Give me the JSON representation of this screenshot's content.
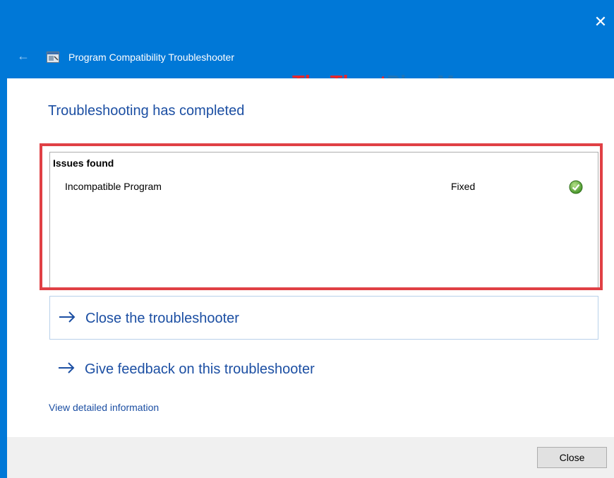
{
  "window": {
    "title": "Program Compatibility Troubleshooter",
    "close_glyph": "✕",
    "back_glyph": "←"
  },
  "watermark": {
    "part1": "ThuThuat",
    "part2": "PhanMem.vn"
  },
  "main": {
    "heading": "Troubleshooting has completed",
    "issues": {
      "title": "Issues found",
      "rows": [
        {
          "name": "Incompatible Program",
          "status": "Fixed",
          "icon": "check-icon"
        }
      ]
    },
    "links": [
      {
        "label": "Close the troubleshooter"
      },
      {
        "label": "Give feedback on this troubleshooter"
      }
    ],
    "detail_link": "View detailed information"
  },
  "footer": {
    "close_label": "Close"
  },
  "colors": {
    "accent": "#0078d7",
    "link": "#1c4fa3",
    "highlight": "#e04045"
  }
}
